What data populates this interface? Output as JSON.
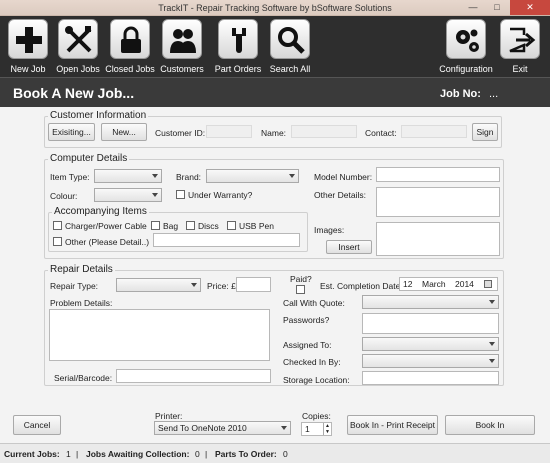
{
  "window": {
    "title": "TrackIT - Repair Tracking Software by bSoftware Solutions",
    "minimize": "—",
    "maximize": "□",
    "close": "✕"
  },
  "toolbar": {
    "new_job": "New Job",
    "open_jobs": "Open Jobs",
    "closed_jobs": "Closed Jobs",
    "customers": "Customers",
    "part_orders": "Part Orders",
    "search_all": "Search All",
    "configuration": "Configuration",
    "exit": "Exit"
  },
  "header": {
    "title": "Book A New Job...",
    "job_no_label": "Job No:",
    "job_no_value": "..."
  },
  "customer": {
    "section": "Customer Information",
    "existing": "Exisiting...",
    "new": "New...",
    "customer_id": "Customer ID:",
    "name": "Name:",
    "contact": "Contact:",
    "sign": "Sign"
  },
  "computer": {
    "section": "Computer Details",
    "item_type": "Item Type:",
    "brand": "Brand:",
    "model_number": "Model Number:",
    "colour": "Colour:",
    "under_warranty": "Under Warranty?",
    "other_details": "Other Details:",
    "accompanying": "Accompanying Items",
    "charger": "Charger/Power Cable",
    "bag": "Bag",
    "discs": "Discs",
    "usb_pen": "USB Pen",
    "other": "Other (Please Detail..)",
    "images": "Images:",
    "insert": "Insert"
  },
  "repair": {
    "section": "Repair Details",
    "repair_type": "Repair Type:",
    "price": "Price: £",
    "paid": "Paid?",
    "est_completion": "Est. Completion Date:",
    "date_day": "12",
    "date_month": "March",
    "date_year": "2014",
    "problem_details": "Problem Details:",
    "call_with_quote": "Call With Quote:",
    "passwords": "Passwords?",
    "assigned_to": "Assigned To:",
    "checked_in_by": "Checked In By:",
    "serial": "Serial/Barcode:",
    "storage_location": "Storage Location:"
  },
  "footer": {
    "cancel": "Cancel",
    "printer_label": "Printer:",
    "printer_value": "Send To OneNote 2010",
    "copies_label": "Copies:",
    "copies_value": "1",
    "book_in_print": "Book In - Print Receipt",
    "book_in": "Book In"
  },
  "status": {
    "current_jobs_label": "Current Jobs:",
    "current_jobs": "1",
    "awaiting_label": "Jobs Awaiting Collection:",
    "awaiting": "0",
    "parts_label": "Parts To Order:",
    "parts": "0"
  },
  "colors": {
    "toolbar_bg": "#2e2e2e",
    "header_bg": "#3a3a3a",
    "title_bar": "#dccbc0"
  }
}
